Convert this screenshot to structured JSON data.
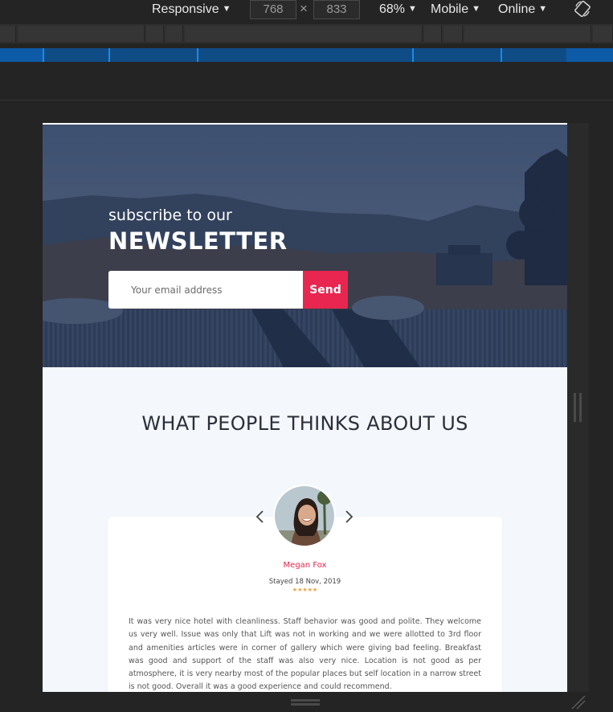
{
  "devtools": {
    "device_label": "Responsive",
    "width_value": "768",
    "height_value": "833",
    "dimension_separator": "×",
    "zoom_label": "68%",
    "device_type_label": "Mobile",
    "network_label": "Online"
  },
  "hero": {
    "subtitle": "subscribe to our",
    "title": "NEWSLETTER",
    "email_placeholder": "Your email address",
    "send_label": "Send"
  },
  "testimonials": {
    "section_title": "WHAT PEOPLE THINKS ABOUT US",
    "reviewer_name": "Megan Fox",
    "stay_date": "Stayed 18 Nov, 2019",
    "rating_stars": 5,
    "stars_text": "★★★★★",
    "review": "It was very nice hotel with cleanliness. Staff behavior was good and polite. They welcome us very well. Issue was only that Lift was not in working and we were allotted to 3rd floor and amenities articles were in corner of gallery which were giving bad feeling. Breakfast was good and support of the staff was also very nice. Location is not good as per atmosphere, it is very nearby most of the popular places but self location in a narrow street is not good. Overall it was a good experience and could recommend."
  },
  "colors": {
    "accent": "#e8264f",
    "star": "#f2a23a",
    "section_bg": "#f4f8fc",
    "devtools_bg": "#242424"
  }
}
